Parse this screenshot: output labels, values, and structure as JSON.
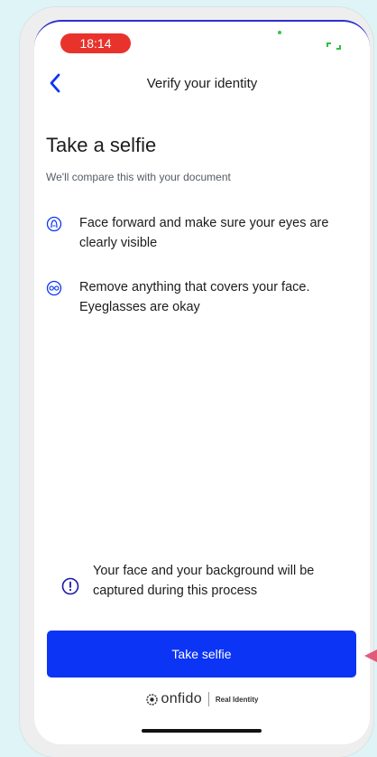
{
  "status_bar": {
    "time": "18:14"
  },
  "nav": {
    "title": "Verify your identity"
  },
  "page": {
    "title": "Take a selfie",
    "subtitle": "We'll compare this with your document"
  },
  "instructions": [
    {
      "icon": "face-forward-icon",
      "text": "Face forward and make sure your eyes are clearly visible"
    },
    {
      "icon": "eyeglasses-icon",
      "text": "Remove anything that covers your face. Eyeglasses are okay"
    }
  ],
  "notice": {
    "icon": "info-circle-icon",
    "text": "Your face and your background will be captured during this process"
  },
  "primary_button": {
    "label": "Take selfie"
  },
  "branding": {
    "name": "onfido",
    "tagline": "Real Identity"
  },
  "colors": {
    "accent": "#0c34f5",
    "time_pill": "#e8332c",
    "background": "#dff4f6"
  }
}
